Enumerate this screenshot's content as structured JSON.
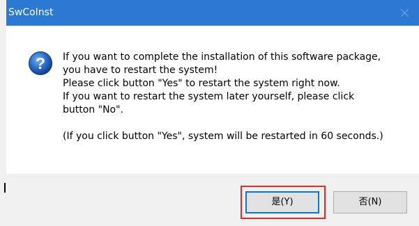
{
  "window": {
    "title": "SwCoInst"
  },
  "message": {
    "lines": [
      "If you want to complete the installation of this software package,",
      "you have to restart the system!",
      "Please click button \"Yes\" to restart the system right now.",
      "If you want to restart the system later yourself, please click",
      "button \"No\"."
    ],
    "note": "(If you click button \"Yes\", system will be restarted in 60 seconds.)"
  },
  "buttons": {
    "yes_label": "是(Y)",
    "no_label": "否(N)"
  },
  "icons": {
    "dialog_icon": "question-icon",
    "close": "close-icon"
  },
  "colors": {
    "titlebar": "#2b79d3",
    "highlight": "#e32b2b",
    "default_button_border": "#0078d7"
  }
}
